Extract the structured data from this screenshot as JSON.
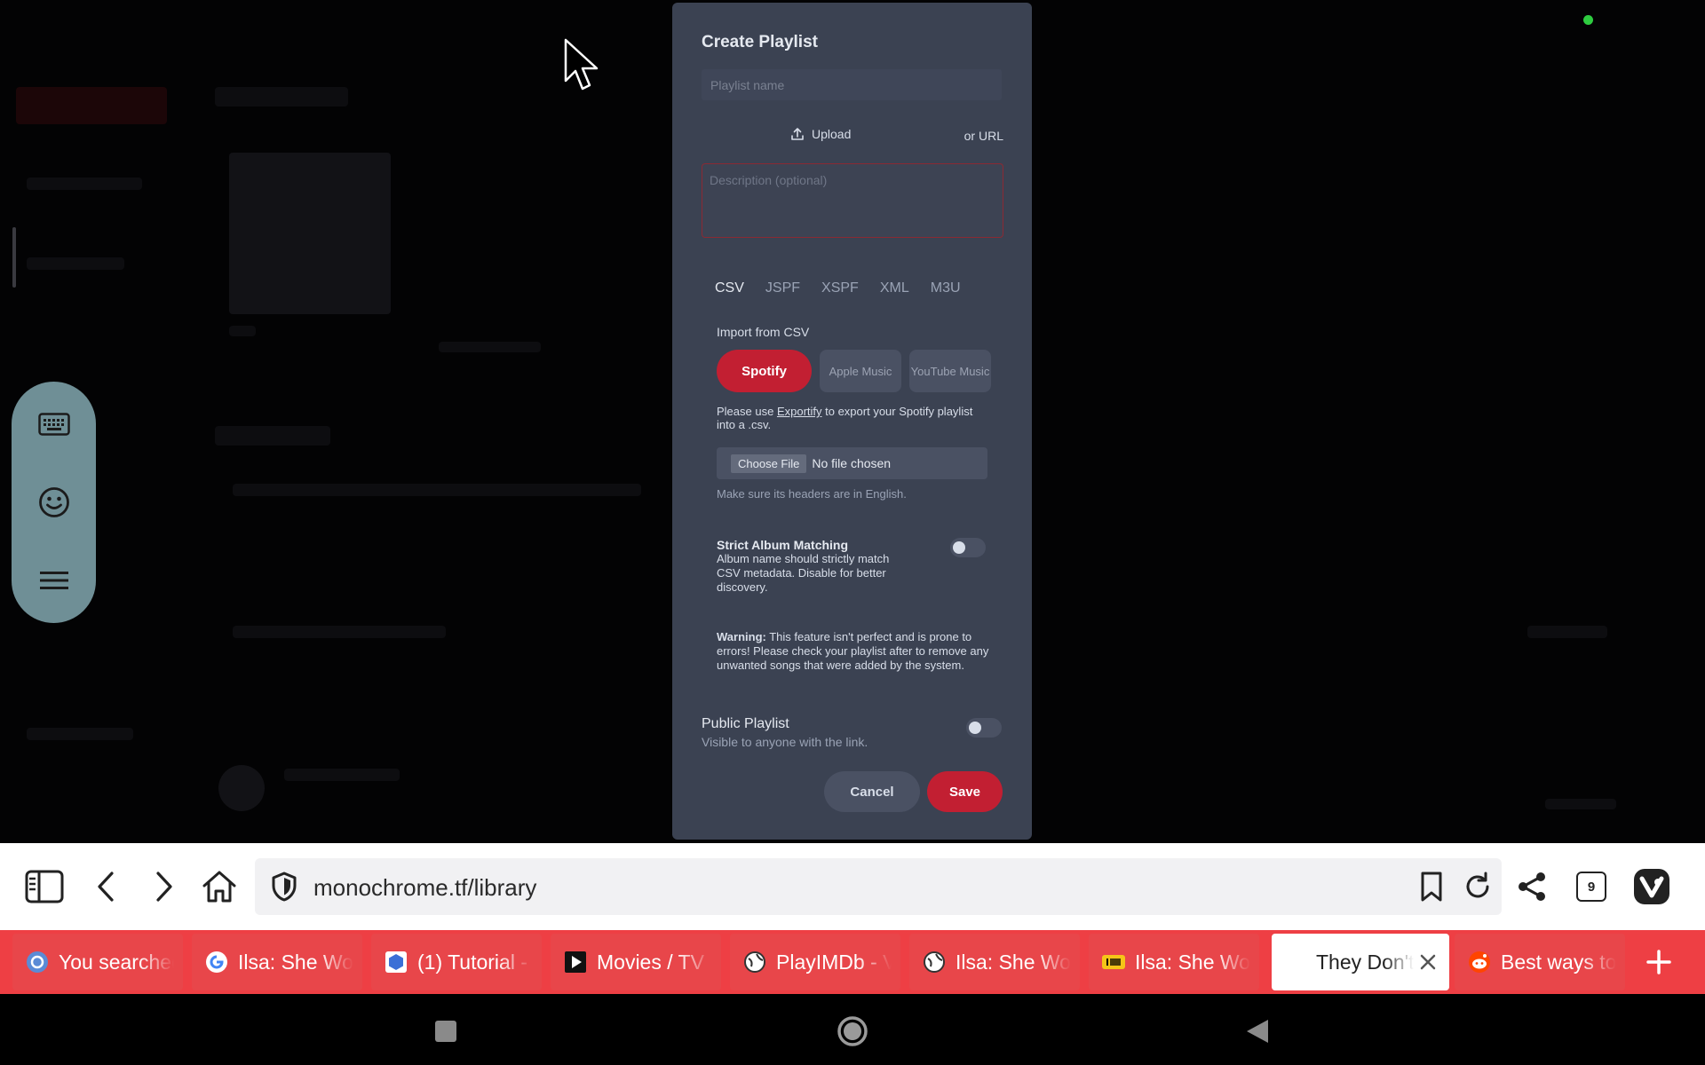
{
  "dialog": {
    "title": "Create Playlist",
    "name_placeholder": "Playlist name",
    "upload_label": "Upload",
    "or_url_label": "or URL",
    "description_placeholder": "Description (optional)",
    "formats": [
      "CSV",
      "JSPF",
      "XSPF",
      "XML",
      "M3U"
    ],
    "active_format": "CSV",
    "import_label": "Import from CSV",
    "sources": {
      "spotify": "Spotify",
      "apple_music": "Apple Music",
      "youtube_music": "YouTube Music"
    },
    "help_prefix": "Please use ",
    "help_link": "Exportify",
    "help_suffix": " to export your Spotify playlist into a .csv.",
    "choose_file_label": "Choose File",
    "no_file_label": "No file chosen",
    "headers_note": "Make sure its headers are in English.",
    "strict_title": "Strict Album Matching",
    "strict_desc": "Album name should strictly match CSV metadata. Disable for better discovery.",
    "strict_enabled": false,
    "warning_label": "Warning:",
    "warning_text": " This feature isn't perfect and is prone to errors! Please check your playlist after to remove any unwanted songs that were added by the system.",
    "public_title": "Public Playlist",
    "public_desc": "Visible to anyone with the link.",
    "public_enabled": false,
    "cancel_label": "Cancel",
    "save_label": "Save"
  },
  "browser": {
    "url": "monochrome.tf/library",
    "tab_count": "9",
    "tabs": [
      {
        "title": "You searched",
        "icon": "search-engine-icon"
      },
      {
        "title": "Ilsa: She Wolf",
        "icon": "google-icon"
      },
      {
        "title": "(1) Tutorial -",
        "icon": "blue-cube-icon"
      },
      {
        "title": "Movies / TV",
        "icon": "play-icon"
      },
      {
        "title": "PlayIMDb - V",
        "icon": "globe-icon"
      },
      {
        "title": "Ilsa: She Wolf",
        "icon": "globe-icon"
      },
      {
        "title": "Ilsa: She Wolf",
        "icon": "imdb-icon"
      },
      {
        "title": "They Don't",
        "icon": "none",
        "active": true
      },
      {
        "title": "Best ways to",
        "icon": "reddit-icon"
      }
    ]
  },
  "colors": {
    "accent_red": "#c21f32",
    "modal_bg": "#3b4252",
    "tabstrip": "#ee3f44"
  }
}
